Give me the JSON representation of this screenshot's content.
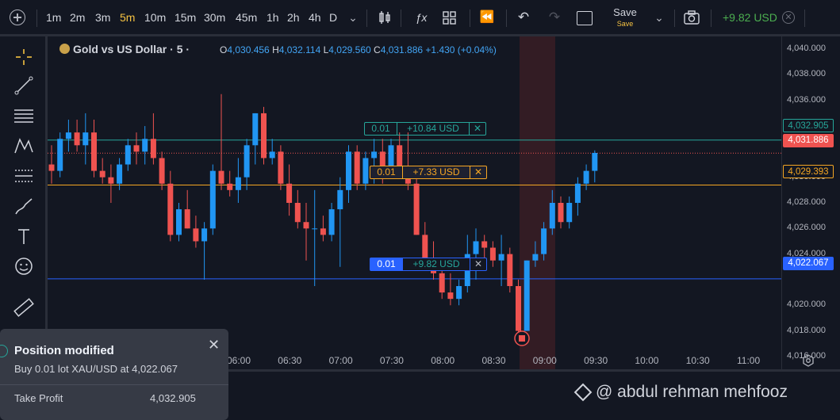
{
  "toolbar": {
    "timeframes": [
      "1m",
      "2m",
      "3m",
      "5m",
      "10m",
      "15m",
      "30m",
      "45m",
      "1h",
      "2h",
      "4h",
      "D"
    ],
    "active_timeframe": "5m",
    "save_label": "Save",
    "save_sublabel": "Save",
    "account_pnl": "+9.82 USD"
  },
  "symbol": {
    "name": "Gold vs US Dollar · 5 ·",
    "ohlc": [
      {
        "k": "O",
        "v": "4,030.456"
      },
      {
        "k": "H",
        "v": "4,032.114"
      },
      {
        "k": "L",
        "v": "4,029.560"
      },
      {
        "k": "C",
        "v": "4,031.886"
      }
    ],
    "change": "+1.430 (+0.04%)"
  },
  "trades": {
    "take_profit": {
      "qty": "0.01",
      "pnl": "+10.84 USD",
      "price": "4,032.905"
    },
    "entry": {
      "qty": "0.01",
      "pnl": "+7.33 USD",
      "price": "4,029.393"
    },
    "position": {
      "qty": "0.01",
      "pnl": "+9.82 USD",
      "price": "4,022.067"
    }
  },
  "current_price": "4,031.886",
  "price_axis_labels": [
    "4,040.000",
    "4,038.000",
    "4,036.000",
    "4,034.000",
    "4,030.000",
    "4,028.000",
    "4,026.000",
    "4,024.000",
    "4,020.000",
    "4,018.000",
    "4,016.000"
  ],
  "time_axis_labels": [
    "06:00",
    "06:30",
    "07:00",
    "07:30",
    "08:00",
    "08:30",
    "09:00",
    "09:30",
    "10:00",
    "10:30",
    "11:00"
  ],
  "colors": {
    "up": "#2196f3",
    "down": "#ef5350",
    "tp": "#26a69a",
    "entry": "#f5a623",
    "position": "#2962ff"
  },
  "chart_data": {
    "type": "candlestick",
    "candles": [
      [
        4031.0,
        4032.5,
        4029.5,
        4030.5
      ],
      [
        4030.5,
        4033.5,
        4030.0,
        4033.0
      ],
      [
        4033.0,
        4034.5,
        4032.0,
        4033.5
      ],
      [
        4033.5,
        4034.5,
        4032.0,
        4032.5
      ],
      [
        4032.5,
        4035.0,
        4031.0,
        4033.5
      ],
      [
        4033.5,
        4034.5,
        4030.0,
        4030.5
      ],
      [
        4030.5,
        4031.5,
        4029.5,
        4030.0
      ],
      [
        4030.0,
        4031.0,
        4028.0,
        4029.5
      ],
      [
        4029.5,
        4031.5,
        4029.0,
        4031.0
      ],
      [
        4031.0,
        4033.0,
        4030.5,
        4032.5
      ],
      [
        4032.5,
        4033.5,
        4031.0,
        4032.0
      ],
      [
        4032.0,
        4034.0,
        4031.0,
        4033.0
      ],
      [
        4033.0,
        4035.0,
        4031.0,
        4031.5
      ],
      [
        4031.5,
        4032.0,
        4029.0,
        4029.5
      ],
      [
        4029.5,
        4030.5,
        4025.0,
        4025.5
      ],
      [
        4025.5,
        4028.0,
        4025.0,
        4027.5
      ],
      [
        4027.5,
        4029.0,
        4026.0,
        4026.0
      ],
      [
        4026.0,
        4027.0,
        4024.5,
        4025.0
      ],
      [
        4025.0,
        4026.5,
        4022.0,
        4026.0
      ],
      [
        4026.0,
        4031.0,
        4025.5,
        4030.5
      ],
      [
        4030.5,
        4036.5,
        4029.0,
        4029.5
      ],
      [
        4029.5,
        4030.5,
        4028.5,
        4029.0
      ],
      [
        4029.0,
        4031.5,
        4028.0,
        4030.0
      ],
      [
        4030.0,
        4033.0,
        4029.0,
        4032.5
      ],
      [
        4032.5,
        4035.0,
        4031.0,
        4035.0
      ],
      [
        4035.0,
        4035.5,
        4031.0,
        4031.5
      ],
      [
        4031.5,
        4033.0,
        4031.0,
        4032.0
      ],
      [
        4032.0,
        4032.5,
        4029.0,
        4029.5
      ],
      [
        4029.5,
        4031.0,
        4027.0,
        4028.0
      ],
      [
        4028.0,
        4029.0,
        4026.0,
        4026.5
      ],
      [
        4026.5,
        4028.0,
        4023.5,
        4026.0
      ],
      [
        4026.0,
        4029.0,
        4021.5,
        4026.0
      ],
      [
        4026.0,
        4027.0,
        4025.0,
        4025.5
      ],
      [
        4025.5,
        4028.0,
        4025.0,
        4027.5
      ],
      [
        4027.5,
        4030.0,
        4023.0,
        4029.0
      ],
      [
        4029.0,
        4032.5,
        4028.0,
        4032.0
      ],
      [
        4032.0,
        4032.5,
        4029.0,
        4029.5
      ],
      [
        4029.5,
        4032.0,
        4029.0,
        4031.5
      ],
      [
        4031.5,
        4033.0,
        4029.5,
        4032.0
      ],
      [
        4032.0,
        4033.0,
        4029.5,
        4030.5
      ],
      [
        4030.5,
        4033.0,
        4030.0,
        4032.5
      ],
      [
        4032.5,
        4033.5,
        4030.0,
        4030.5
      ],
      [
        4030.5,
        4033.5,
        4029.0,
        4029.5
      ],
      [
        4029.5,
        4030.0,
        4025.5,
        4025.5
      ],
      [
        4025.5,
        4026.5,
        4023.0,
        4023.5
      ],
      [
        4023.5,
        4025.0,
        4022.0,
        4022.5
      ],
      [
        4022.5,
        4023.5,
        4020.5,
        4021.0
      ],
      [
        4021.0,
        4022.5,
        4020.0,
        4020.5
      ],
      [
        4020.5,
        4022.0,
        4020.0,
        4021.5
      ],
      [
        4021.5,
        4025.5,
        4021.0,
        4024.0
      ],
      [
        4024.0,
        4026.0,
        4022.0,
        4025.0
      ],
      [
        4025.0,
        4025.5,
        4023.0,
        4024.5
      ],
      [
        4024.5,
        4025.0,
        4023.0,
        4023.5
      ],
      [
        4023.5,
        4025.5,
        4021.5,
        4024.0
      ],
      [
        4024.0,
        4024.5,
        4021.0,
        4021.5
      ],
      [
        4021.5,
        4022.0,
        4017.5,
        4018.0
      ],
      [
        4018.0,
        4023.5,
        4018.0,
        4023.5
      ],
      [
        4023.5,
        4025.0,
        4023.0,
        4024.0
      ],
      [
        4024.0,
        4026.5,
        4023.5,
        4026.0
      ],
      [
        4026.0,
        4029.0,
        4025.5,
        4028.0
      ],
      [
        4028.0,
        4028.5,
        4026.0,
        4026.5
      ],
      [
        4026.5,
        4028.5,
        4026.0,
        4028.0
      ],
      [
        4028.0,
        4030.0,
        4027.0,
        4029.5
      ],
      [
        4029.5,
        4031.0,
        4029.0,
        4030.5
      ],
      [
        4030.5,
        4032.1,
        4029.6,
        4031.9
      ]
    ],
    "candle_fields": [
      "open",
      "high",
      "low",
      "close"
    ],
    "ylim": [
      4015.0,
      4041.0
    ],
    "x_ticks": [
      "06:00",
      "06:30",
      "07:00",
      "07:30",
      "08:00",
      "08:30",
      "09:00",
      "09:30",
      "10:00",
      "10:30",
      "11:00"
    ]
  },
  "toast": {
    "title": "Position modified",
    "message": "Buy 0.01 lot XAU/USD at 4,022.067",
    "field_label": "Take Profit",
    "field_value": "4,032.905"
  },
  "watermark": "@ abdul rehman mehfooz"
}
